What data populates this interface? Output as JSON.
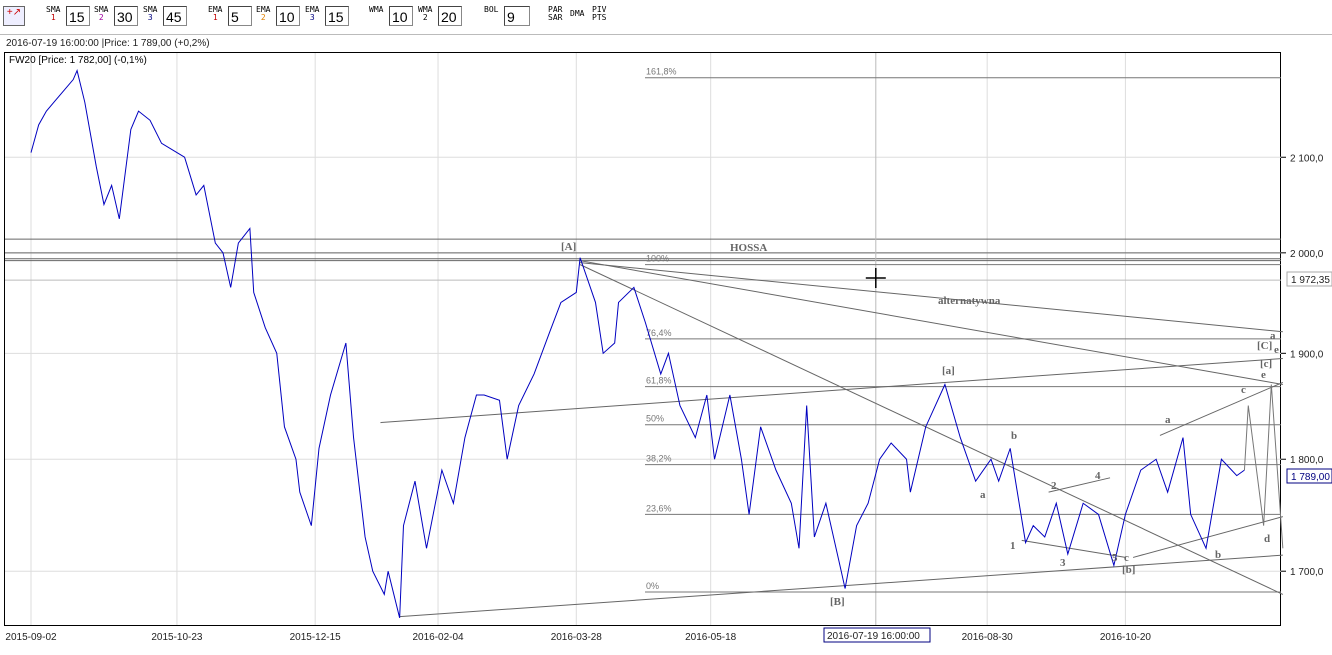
{
  "toolbar": {
    "items": [
      {
        "name": "sma1",
        "label": "SMA",
        "sub": "1",
        "sub_color": "#c00000",
        "value": "15"
      },
      {
        "name": "sma2",
        "label": "SMA",
        "sub": "2",
        "sub_color": "#a000a0",
        "value": "30"
      },
      {
        "name": "sma3",
        "label": "SMA",
        "sub": "3",
        "sub_color": "#000080",
        "value": "45"
      },
      {
        "name": "ema1",
        "label": "EMA",
        "sub": "1",
        "sub_color": "#c00000",
        "value": "5"
      },
      {
        "name": "ema2",
        "label": "EMA",
        "sub": "2",
        "sub_color": "#e08000",
        "value": "10"
      },
      {
        "name": "ema3",
        "label": "EMA",
        "sub": "3",
        "sub_color": "#000080",
        "value": "15"
      },
      {
        "name": "wma1",
        "label": "WMA",
        "sub": "",
        "sub_color": "#000",
        "value": "10"
      },
      {
        "name": "wma2",
        "label": "WMA",
        "sub": "2",
        "sub_color": "#000",
        "value": "20"
      },
      {
        "name": "bol",
        "label": "BOL",
        "sub": "",
        "sub_color": "#000",
        "value": "9"
      }
    ],
    "par_sar": [
      "PAR",
      "SAR"
    ],
    "dma": "DMA",
    "piv_pts": [
      "PIV",
      "PTS"
    ]
  },
  "info_line": "2016-07-19 16:00:00 |Price: 1 789,00 (+0,2%)",
  "chart_title": "FW20 [Price: 1 782,00] (-0,1%)",
  "crosshair": {
    "date_label": "2016-07-19 16:00:00",
    "price_label": "1 972,35",
    "date_idx": 220,
    "price": 1972.35
  },
  "current_price_label": "1 789,00",
  "chart_data": {
    "type": "line",
    "title": "FW20",
    "scale": "log",
    "ylim": [
      1640,
      2220
    ],
    "y_ticks": [
      {
        "v": 2100,
        "label": "2 100,0"
      },
      {
        "v": 2000,
        "label": "2 000,0"
      },
      {
        "v": 1900,
        "label": "1 900,0"
      },
      {
        "v": 1800,
        "label": "1 800,0"
      },
      {
        "v": 1700,
        "label": "1 700,0"
      }
    ],
    "x_ticks": [
      {
        "i": 0,
        "label": "2015-09-02"
      },
      {
        "i": 38,
        "label": "2015-10-23"
      },
      {
        "i": 74,
        "label": "2015-12-15"
      },
      {
        "i": 106,
        "label": "2016-02-04"
      },
      {
        "i": 142,
        "label": "2016-03-28"
      },
      {
        "i": 177,
        "label": "2016-05-18"
      },
      {
        "i": 249,
        "label": "2016-08-30"
      },
      {
        "i": 285,
        "label": "2016-10-20"
      }
    ],
    "series": [
      {
        "name": "FW20",
        "color": "#0000c0",
        "points": [
          [
            0,
            2105
          ],
          [
            2,
            2135
          ],
          [
            4,
            2150
          ],
          [
            6,
            2160
          ],
          [
            8,
            2170
          ],
          [
            11,
            2185
          ],
          [
            12,
            2195
          ],
          [
            14,
            2160
          ],
          [
            17,
            2090
          ],
          [
            19,
            2050
          ],
          [
            21,
            2070
          ],
          [
            23,
            2035
          ],
          [
            26,
            2130
          ],
          [
            28,
            2150
          ],
          [
            31,
            2140
          ],
          [
            34,
            2115
          ],
          [
            38,
            2105
          ],
          [
            40,
            2100
          ],
          [
            43,
            2060
          ],
          [
            45,
            2070
          ],
          [
            48,
            2010
          ],
          [
            50,
            2000
          ],
          [
            52,
            1965
          ],
          [
            54,
            2010
          ],
          [
            57,
            2025
          ],
          [
            58,
            1960
          ],
          [
            61,
            1925
          ],
          [
            64,
            1900
          ],
          [
            66,
            1830
          ],
          [
            69,
            1800
          ],
          [
            70,
            1770
          ],
          [
            73,
            1740
          ],
          [
            75,
            1810
          ],
          [
            78,
            1860
          ],
          [
            82,
            1910
          ],
          [
            84,
            1820
          ],
          [
            87,
            1730
          ],
          [
            89,
            1700
          ],
          [
            92,
            1680
          ],
          [
            93,
            1700
          ],
          [
            96,
            1660
          ],
          [
            97,
            1740
          ],
          [
            100,
            1780
          ],
          [
            103,
            1720
          ],
          [
            107,
            1790
          ],
          [
            110,
            1760
          ],
          [
            113,
            1820
          ],
          [
            116,
            1860
          ],
          [
            118,
            1860
          ],
          [
            122,
            1855
          ],
          [
            124,
            1800
          ],
          [
            127,
            1850
          ],
          [
            131,
            1880
          ],
          [
            135,
            1920
          ],
          [
            138,
            1950
          ],
          [
            142,
            1960
          ],
          [
            143,
            1995
          ],
          [
            147,
            1950
          ],
          [
            149,
            1900
          ],
          [
            152,
            1910
          ],
          [
            153,
            1950
          ],
          [
            157,
            1965
          ],
          [
            160,
            1930
          ],
          [
            164,
            1880
          ],
          [
            166,
            1900
          ],
          [
            169,
            1850
          ],
          [
            173,
            1820
          ],
          [
            176,
            1860
          ],
          [
            178,
            1800
          ],
          [
            182,
            1860
          ],
          [
            185,
            1800
          ],
          [
            187,
            1750
          ],
          [
            190,
            1830
          ],
          [
            194,
            1790
          ],
          [
            198,
            1760
          ],
          [
            200,
            1720
          ],
          [
            202,
            1850
          ],
          [
            204,
            1730
          ],
          [
            207,
            1760
          ],
          [
            211,
            1700
          ],
          [
            212,
            1685
          ],
          [
            215,
            1740
          ],
          [
            218,
            1760
          ],
          [
            221,
            1800
          ],
          [
            224,
            1815
          ],
          [
            228,
            1800
          ],
          [
            229,
            1770
          ],
          [
            233,
            1830
          ],
          [
            238,
            1870
          ],
          [
            242,
            1820
          ],
          [
            246,
            1780
          ],
          [
            250,
            1800
          ],
          [
            252,
            1780
          ],
          [
            255,
            1810
          ],
          [
            259,
            1725
          ],
          [
            261,
            1740
          ],
          [
            264,
            1730
          ],
          [
            267,
            1760
          ],
          [
            270,
            1715
          ],
          [
            274,
            1760
          ],
          [
            278,
            1750
          ],
          [
            282,
            1705
          ],
          [
            285,
            1750
          ],
          [
            289,
            1790
          ],
          [
            293,
            1800
          ],
          [
            296,
            1770
          ],
          [
            300,
            1820
          ],
          [
            302,
            1750
          ],
          [
            306,
            1720
          ],
          [
            310,
            1800
          ],
          [
            314,
            1785
          ],
          [
            316,
            1790
          ]
        ]
      },
      {
        "name": "projection",
        "color": "#777777",
        "points": [
          [
            316,
            1790
          ],
          [
            317,
            1850
          ],
          [
            321,
            1740
          ],
          [
            323,
            1870
          ],
          [
            326,
            1720
          ]
        ]
      }
    ],
    "fibonacci": [
      {
        "label": "161,8%",
        "v": 2187
      },
      {
        "label": "100%",
        "v": 1988
      },
      {
        "label": "76,4%",
        "v": 1914
      },
      {
        "label": "61,8%",
        "v": 1868
      },
      {
        "label": "50%",
        "v": 1832
      },
      {
        "label": "38,2%",
        "v": 1795
      },
      {
        "label": "23,6%",
        "v": 1750
      },
      {
        "label": "0%",
        "v": 1682
      }
    ],
    "hlines": [
      2014,
      2000,
      1994,
      1992
    ],
    "trendlines": [
      [
        [
          143,
          1990
        ],
        [
          326,
          1921
        ]
      ],
      [
        [
          143,
          1992
        ],
        [
          326,
          1870
        ]
      ],
      [
        [
          143,
          1988
        ],
        [
          326,
          1680
        ]
      ],
      [
        [
          91,
          1834
        ],
        [
          326,
          1895
        ]
      ],
      [
        [
          96,
          1661
        ],
        [
          326,
          1714
        ]
      ],
      [
        [
          294,
          1822
        ],
        [
          326,
          1872
        ]
      ],
      [
        [
          287,
          1712
        ],
        [
          326,
          1748
        ]
      ],
      [
        [
          258,
          1727
        ],
        [
          285,
          1712
        ]
      ],
      [
        [
          265,
          1770
        ],
        [
          281,
          1783
        ]
      ]
    ],
    "annotations": [
      "[A]",
      "HOSSA",
      "alternatywna",
      "[a]",
      "[B]",
      "b",
      "a",
      "1",
      "2",
      "3",
      "4",
      "5",
      "c",
      "[b]",
      "a",
      "b",
      "c",
      "d",
      "e",
      "[c]",
      "[C]",
      "e",
      "a"
    ]
  }
}
